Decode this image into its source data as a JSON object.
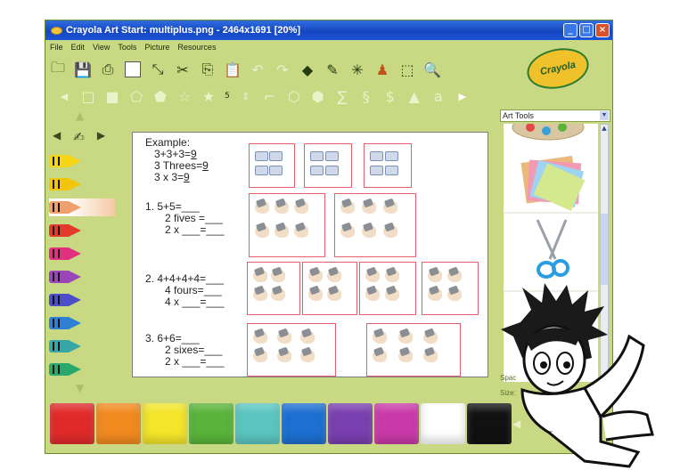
{
  "window": {
    "title": "Crayola Art Start: multiplus.png - 2464x1691 [20%]",
    "controls": [
      "minimize",
      "maximize",
      "close"
    ]
  },
  "menu": [
    "File",
    "Edit",
    "View",
    "Tools",
    "Picture",
    "Resources"
  ],
  "toolbar_icons": [
    "open-icon",
    "save-icon",
    "print-icon",
    "new-canvas-icon",
    "select-icon",
    "cut-icon",
    "copy-icon",
    "paste-icon",
    "undo-icon",
    "redo-icon",
    "eraser-icon",
    "pencil-icon",
    "sparkle-icon",
    "stamp-icon",
    "marquee-icon",
    "zoom-icon"
  ],
  "shapes_bar": {
    "size_value": "5"
  },
  "logo_text": "Crayola",
  "worksheet": {
    "example": {
      "heading": "Example:",
      "line1_pre": "3+3+3=",
      "line1_ans": "9",
      "line2_pre": "3 Threes=",
      "line2_ans": "9",
      "line3_pre": "3 x 3=",
      "line3_ans": "9"
    },
    "q1": {
      "line1": "1.   5+5=___",
      "line2": "2 fives =___",
      "line3": "2 x ___=___"
    },
    "q2": {
      "line1": "2.   4+4+4+4=___",
      "line2": "4 fours=___",
      "line3": "4 x ___=___"
    },
    "q3": {
      "line1": "3.   6+6=___",
      "line2": "2 sixes=___",
      "line3": "2 x ___=___"
    }
  },
  "right_panel": {
    "dropdown_value": "Art Tools",
    "label_spacing": "Spac",
    "label_size": "Size:"
  },
  "crayon_colors": [
    "#f6d517",
    "#f2c50a",
    "#f0a06c",
    "#e23a2c",
    "#e0307f",
    "#9a45b8",
    "#4b4ec7",
    "#2f7fd4",
    "#36a6a6",
    "#2aa86c"
  ],
  "palette_colors": [
    "#e02a2a",
    "#f18a1f",
    "#f4e52a",
    "#5ab43a",
    "#5bc6c0",
    "#1d6fd1",
    "#7a3fb0",
    "#c93aa8",
    "#ffffff",
    "#111111"
  ],
  "colors": {
    "titlebar": "#1546c2",
    "frame": "#c9d883",
    "card_border": "#e7606b"
  }
}
